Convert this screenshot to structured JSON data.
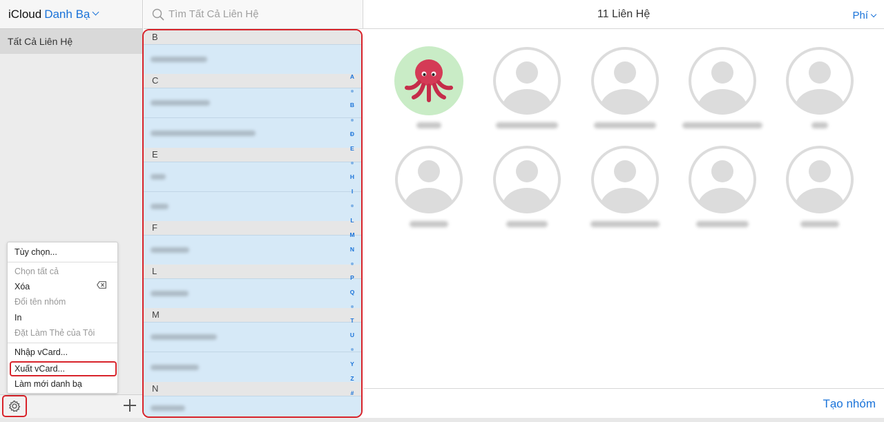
{
  "app": {
    "brand": "iCloud",
    "section": "Danh Bạ"
  },
  "sidebar": {
    "all_contacts": "Tất Cả Liên Hệ"
  },
  "search": {
    "placeholder": "Tìm Tất Cả Liên Hệ"
  },
  "list": {
    "headers": [
      "B",
      "C",
      "E",
      "F",
      "L",
      "M",
      "N"
    ],
    "index": [
      "A",
      "B",
      "Đ",
      "E",
      "H",
      "I",
      "L",
      "M",
      "N",
      "P",
      "Q",
      "T",
      "U",
      "Y",
      "Z",
      "#"
    ]
  },
  "menu": {
    "items": [
      {
        "label": "Tùy chọn...",
        "enabled": true
      },
      {
        "label": "Chọn tất cả",
        "enabled": false
      },
      {
        "label": "Xóa",
        "enabled": true
      },
      {
        "label": "Đổi tên nhóm",
        "enabled": false
      },
      {
        "label": "In",
        "enabled": true
      },
      {
        "label": "Đặt Làm Thẻ của Tôi",
        "enabled": false
      },
      {
        "label": "Nhập vCard...",
        "enabled": true
      },
      {
        "label": "Xuất vCard...",
        "enabled": true,
        "highlighted": true
      },
      {
        "label": "Làm mới danh bạ",
        "enabled": true
      }
    ]
  },
  "main": {
    "count_label": "11 Liên Hệ",
    "sort_label": "Phí",
    "new_group_label": "Tạo nhóm"
  },
  "colors": {
    "accent": "#1a73d9",
    "highlight": "#d8232a",
    "selected_row": "#d6e9f7"
  },
  "icons": {
    "avatar_first": "octopus-avatar-icon",
    "avatar_default": "person-silhouette-icon"
  }
}
